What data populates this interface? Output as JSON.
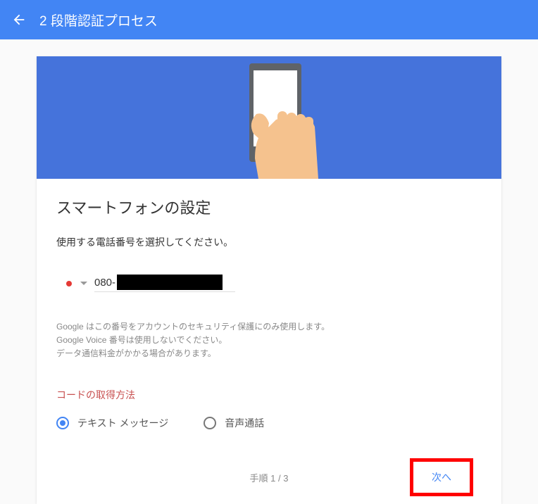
{
  "header": {
    "title": "2 段階認証プロセス"
  },
  "content": {
    "section_title": "スマートフォンの設定",
    "instruction": "使用する電話番号を選択してください。",
    "phone_prefix": "080-",
    "disclaimer_1": "Google はこの番号をアカウントのセキュリティ保護にのみ使用します。",
    "disclaimer_2": "Google Voice 番号は使用しないでください。",
    "disclaimer_3": "データ通信料金がかかる場合があります。",
    "method_title": "コードの取得方法",
    "radio_text": "テキスト メッセージ",
    "radio_voice": "音声通話"
  },
  "footer": {
    "step": "手順 1 / 3",
    "next": "次へ"
  }
}
